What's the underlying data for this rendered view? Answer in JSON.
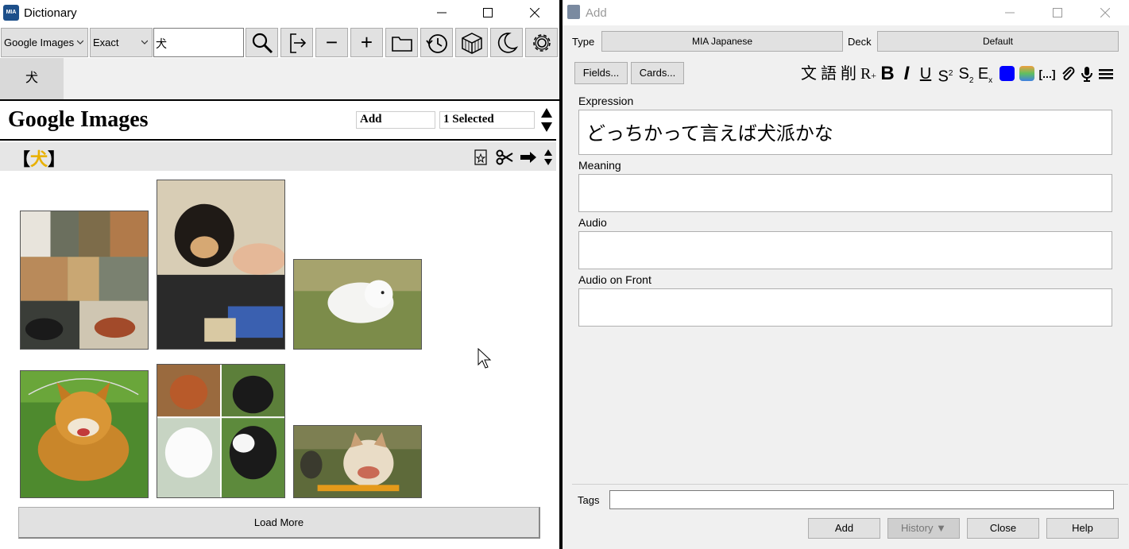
{
  "dictionary_window": {
    "title": "Dictionary",
    "app_logo_text": "MIA",
    "toolbar": {
      "dictionary_select": "Google Images",
      "match_select": "Exact",
      "search_value": "犬",
      "icons": [
        "search-icon",
        "export-icon",
        "zoom-out-icon",
        "zoom-in-icon",
        "folder-icon",
        "history-icon",
        "cube-icon",
        "night-mode-icon",
        "settings-icon"
      ],
      "zoom_out_glyph": "−",
      "zoom_in_glyph": "+"
    },
    "history_tab": "犬",
    "results": {
      "dictionary_name": "Google Images",
      "add_box": "Add",
      "selected_box": "1 Selected",
      "term_open": "【",
      "term": "犬",
      "term_close": "】",
      "load_more": "Load More"
    }
  },
  "add_window": {
    "title": "Add",
    "type_label": "Type",
    "type_value": "MIA Japanese",
    "deck_label": "Deck",
    "deck_value": "Default",
    "fields_button": "Fields...",
    "cards_button": "Cards...",
    "format_glyphs": {
      "furigana": "文",
      "definition": "語",
      "remove": "削",
      "reading": "R",
      "reading_plus": "+",
      "bold": "B",
      "italic": "I",
      "underline": "U",
      "superscript": "S",
      "superscript_mark": "2",
      "subscript": "S",
      "subscript_mark": "2",
      "clear": "E",
      "clear_mark": "x",
      "cloze": "[...]"
    },
    "fields": [
      {
        "label": "Expression",
        "value": "どっちかって言えば犬派かな"
      },
      {
        "label": "Meaning",
        "value": ""
      },
      {
        "label": "Audio",
        "value": ""
      },
      {
        "label": "Audio on Front",
        "value": ""
      }
    ],
    "tags_label": "Tags",
    "tags_value": "",
    "buttons": {
      "add": "Add",
      "history": "History ▼",
      "close": "Close",
      "help": "Help"
    },
    "colors": {
      "text_color": "#0000ff"
    }
  }
}
